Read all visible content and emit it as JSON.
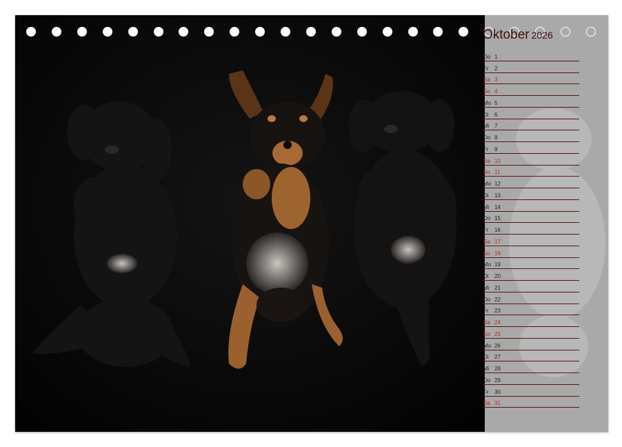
{
  "calendar": {
    "month": "Oktober",
    "year": "2026",
    "colors": {
      "weekday": "#1f1f1f",
      "weekend": "#b3262b",
      "rule": "#5b1415",
      "panel": "#a9a9a9",
      "title": "#3d0f10"
    },
    "days": [
      {
        "wd": "Do",
        "d": "1",
        "we": false
      },
      {
        "wd": "Fr",
        "d": "2",
        "we": false
      },
      {
        "wd": "Sa",
        "d": "3",
        "we": true
      },
      {
        "wd": "So",
        "d": "4",
        "we": true
      },
      {
        "wd": "Mo",
        "d": "5",
        "we": false
      },
      {
        "wd": "Di",
        "d": "6",
        "we": false
      },
      {
        "wd": "Mi",
        "d": "7",
        "we": false
      },
      {
        "wd": "Do",
        "d": "8",
        "we": false
      },
      {
        "wd": "Fr",
        "d": "9",
        "we": false
      },
      {
        "wd": "Sa",
        "d": "10",
        "we": true
      },
      {
        "wd": "So",
        "d": "11",
        "we": true
      },
      {
        "wd": "Mo",
        "d": "12",
        "we": false
      },
      {
        "wd": "Di",
        "d": "13",
        "we": false
      },
      {
        "wd": "Mi",
        "d": "14",
        "we": false
      },
      {
        "wd": "Do",
        "d": "15",
        "we": false
      },
      {
        "wd": "Fr",
        "d": "16",
        "we": false
      },
      {
        "wd": "Sa",
        "d": "17",
        "we": true
      },
      {
        "wd": "So",
        "d": "18",
        "we": true
      },
      {
        "wd": "Mo",
        "d": "19",
        "we": false
      },
      {
        "wd": "Di",
        "d": "20",
        "we": false
      },
      {
        "wd": "Mi",
        "d": "21",
        "we": false
      },
      {
        "wd": "Do",
        "d": "22",
        "we": false
      },
      {
        "wd": "Fr",
        "d": "23",
        "we": false
      },
      {
        "wd": "Sa",
        "d": "24",
        "we": true
      },
      {
        "wd": "So",
        "d": "25",
        "we": true
      },
      {
        "wd": "Mo",
        "d": "26",
        "we": false
      },
      {
        "wd": "Di",
        "d": "27",
        "we": false
      },
      {
        "wd": "Mi",
        "d": "28",
        "we": false
      },
      {
        "wd": "Do",
        "d": "29",
        "we": false
      },
      {
        "wd": "Fr",
        "d": "30",
        "we": false
      },
      {
        "wd": "Sa",
        "d": "31",
        "we": true
      }
    ]
  },
  "photo": {
    "subject": "three puppies lying on their backs on a black background"
  },
  "binding": {
    "holes_on_photo": 18,
    "holes_on_panel": 5
  }
}
